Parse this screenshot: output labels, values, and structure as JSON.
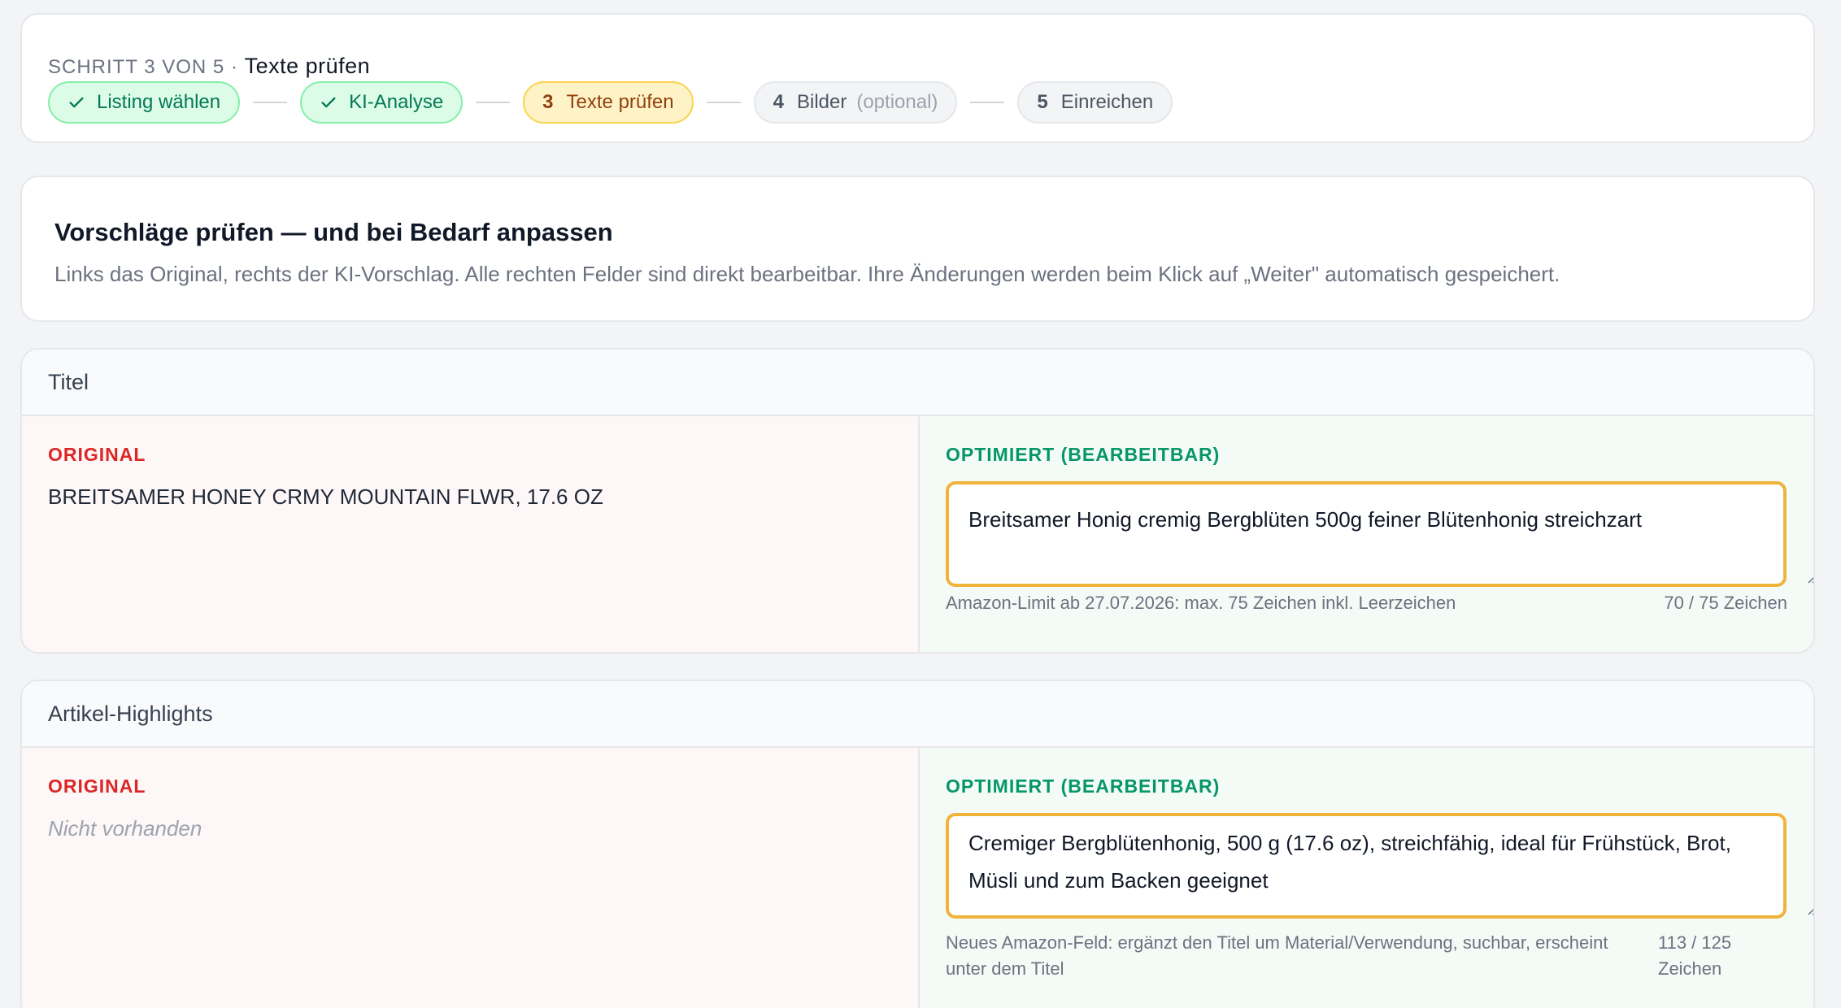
{
  "stepper": {
    "label": "SCHRITT 3 VON 5",
    "separator": "·",
    "current": "Texte prüfen",
    "steps": [
      {
        "number": "",
        "label": "Listing wählen",
        "state": "done",
        "icon": "check-icon"
      },
      {
        "number": "",
        "label": "KI-Analyse",
        "state": "done",
        "icon": "check-icon"
      },
      {
        "number": "3",
        "label": "Texte prüfen",
        "state": "active"
      },
      {
        "number": "4",
        "label": "Bilder",
        "note": "(optional)",
        "state": "todo"
      },
      {
        "number": "5",
        "label": "Einreichen",
        "state": "todo"
      }
    ]
  },
  "intro": {
    "heading": "Vorschläge prüfen — und bei Bedarf anpassen",
    "text": "Links das Original, rechts der KI-Vorschlag. Alle rechten Felder sind direkt bearbeitbar. Ihre Änderungen werden beim Klick auf „Weiter\" automatisch gespeichert."
  },
  "sections": {
    "title": {
      "heading": "Titel",
      "original_label": "ORIGINAL",
      "original_value": "BREITSAMER HONEY CRMY MOUNTAIN FLWR, 17.6 OZ",
      "optimized_label": "OPTIMIERT (BEARBEITBAR)",
      "optimized_value": "Breitsamer Honig cremig Bergblüten 500g feiner Blütenhonig streichzart",
      "hint": "Amazon-Limit ab 27.07.2026: max. 75 Zeichen inkl. Leerzeichen",
      "counter": "70 / 75 Zeichen"
    },
    "highlights": {
      "heading": "Artikel-Highlights",
      "original_label": "ORIGINAL",
      "original_value": "Nicht vorhanden",
      "optimized_label": "OPTIMIERT (BEARBEITBAR)",
      "optimized_value": "Cremiger Bergblütenhonig, 500 g (17.6 oz), streichfähig, ideal für Frühstück, Brot, Müsli und zum Backen geeignet",
      "hint": "Neues Amazon-Feld: ergänzt den Titel um Material/Verwendung, suchbar, erscheint unter dem Titel",
      "counter": "113 / 125 Zeichen"
    }
  },
  "colors": {
    "done": "#047857",
    "active": "#92400e",
    "original_label": "#dc2626",
    "optimized_label": "#059669",
    "edit_border": "#f0b43c"
  }
}
